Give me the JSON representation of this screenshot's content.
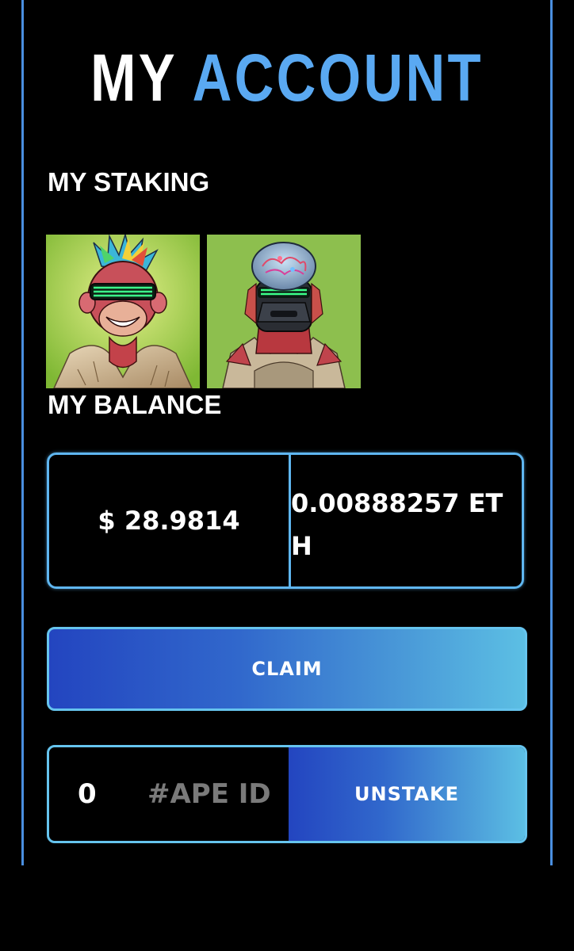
{
  "header": {
    "title_word1": "MY",
    "title_word2": "ACCOUNT"
  },
  "staking": {
    "label": "MY STAKING",
    "nfts": [
      {
        "name": "nft-ape-neon-visor"
      },
      {
        "name": "nft-ape-brain-helmet"
      }
    ]
  },
  "balance": {
    "label": "MY BALANCE",
    "usd": "$ 28.9814",
    "eth": "0.00888257 ETH"
  },
  "actions": {
    "claim_label": "CLAIM",
    "ape_id_value": "0",
    "ape_id_placeholder": "#APE ID",
    "unstake_label": "UNSTAKE"
  },
  "colors": {
    "accent": "#5aa9f2",
    "border": "#5fb6f0",
    "gradient_start": "#2345c0",
    "gradient_end": "#5cbfe4",
    "background": "#000000"
  }
}
